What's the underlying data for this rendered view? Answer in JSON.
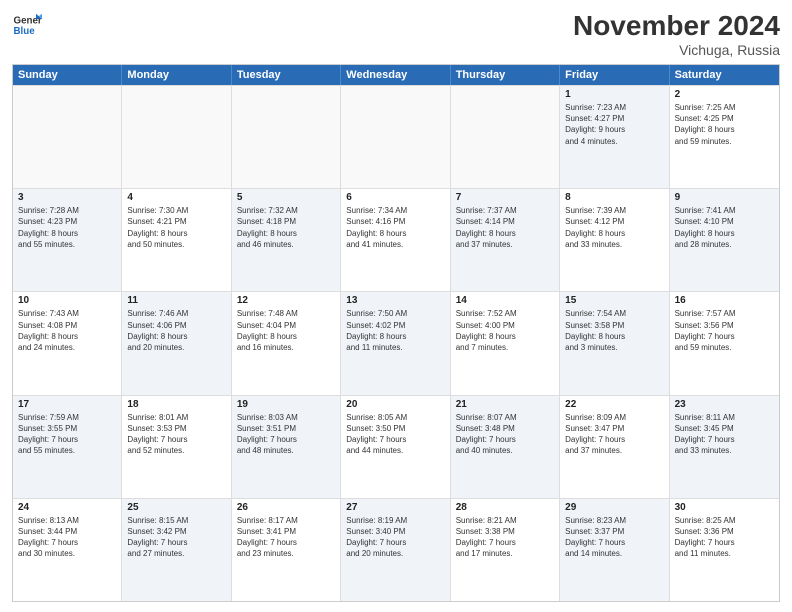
{
  "logo": {
    "line1": "General",
    "line2": "Blue"
  },
  "title": "November 2024",
  "location": "Vichuga, Russia",
  "days": [
    "Sunday",
    "Monday",
    "Tuesday",
    "Wednesday",
    "Thursday",
    "Friday",
    "Saturday"
  ],
  "rows": [
    [
      {
        "day": "",
        "text": "",
        "empty": true
      },
      {
        "day": "",
        "text": "",
        "empty": true
      },
      {
        "day": "",
        "text": "",
        "empty": true
      },
      {
        "day": "",
        "text": "",
        "empty": true
      },
      {
        "day": "",
        "text": "",
        "empty": true
      },
      {
        "day": "1",
        "text": "Sunrise: 7:23 AM\nSunset: 4:27 PM\nDaylight: 9 hours\nand 4 minutes.",
        "alt": true
      },
      {
        "day": "2",
        "text": "Sunrise: 7:25 AM\nSunset: 4:25 PM\nDaylight: 8 hours\nand 59 minutes.",
        "alt": false
      }
    ],
    [
      {
        "day": "3",
        "text": "Sunrise: 7:28 AM\nSunset: 4:23 PM\nDaylight: 8 hours\nand 55 minutes.",
        "alt": true
      },
      {
        "day": "4",
        "text": "Sunrise: 7:30 AM\nSunset: 4:21 PM\nDaylight: 8 hours\nand 50 minutes.",
        "alt": false
      },
      {
        "day": "5",
        "text": "Sunrise: 7:32 AM\nSunset: 4:18 PM\nDaylight: 8 hours\nand 46 minutes.",
        "alt": true
      },
      {
        "day": "6",
        "text": "Sunrise: 7:34 AM\nSunset: 4:16 PM\nDaylight: 8 hours\nand 41 minutes.",
        "alt": false
      },
      {
        "day": "7",
        "text": "Sunrise: 7:37 AM\nSunset: 4:14 PM\nDaylight: 8 hours\nand 37 minutes.",
        "alt": true
      },
      {
        "day": "8",
        "text": "Sunrise: 7:39 AM\nSunset: 4:12 PM\nDaylight: 8 hours\nand 33 minutes.",
        "alt": false
      },
      {
        "day": "9",
        "text": "Sunrise: 7:41 AM\nSunset: 4:10 PM\nDaylight: 8 hours\nand 28 minutes.",
        "alt": true
      }
    ],
    [
      {
        "day": "10",
        "text": "Sunrise: 7:43 AM\nSunset: 4:08 PM\nDaylight: 8 hours\nand 24 minutes.",
        "alt": false
      },
      {
        "day": "11",
        "text": "Sunrise: 7:46 AM\nSunset: 4:06 PM\nDaylight: 8 hours\nand 20 minutes.",
        "alt": true
      },
      {
        "day": "12",
        "text": "Sunrise: 7:48 AM\nSunset: 4:04 PM\nDaylight: 8 hours\nand 16 minutes.",
        "alt": false
      },
      {
        "day": "13",
        "text": "Sunrise: 7:50 AM\nSunset: 4:02 PM\nDaylight: 8 hours\nand 11 minutes.",
        "alt": true
      },
      {
        "day": "14",
        "text": "Sunrise: 7:52 AM\nSunset: 4:00 PM\nDaylight: 8 hours\nand 7 minutes.",
        "alt": false
      },
      {
        "day": "15",
        "text": "Sunrise: 7:54 AM\nSunset: 3:58 PM\nDaylight: 8 hours\nand 3 minutes.",
        "alt": true
      },
      {
        "day": "16",
        "text": "Sunrise: 7:57 AM\nSunset: 3:56 PM\nDaylight: 7 hours\nand 59 minutes.",
        "alt": false
      }
    ],
    [
      {
        "day": "17",
        "text": "Sunrise: 7:59 AM\nSunset: 3:55 PM\nDaylight: 7 hours\nand 55 minutes.",
        "alt": true
      },
      {
        "day": "18",
        "text": "Sunrise: 8:01 AM\nSunset: 3:53 PM\nDaylight: 7 hours\nand 52 minutes.",
        "alt": false
      },
      {
        "day": "19",
        "text": "Sunrise: 8:03 AM\nSunset: 3:51 PM\nDaylight: 7 hours\nand 48 minutes.",
        "alt": true
      },
      {
        "day": "20",
        "text": "Sunrise: 8:05 AM\nSunset: 3:50 PM\nDaylight: 7 hours\nand 44 minutes.",
        "alt": false
      },
      {
        "day": "21",
        "text": "Sunrise: 8:07 AM\nSunset: 3:48 PM\nDaylight: 7 hours\nand 40 minutes.",
        "alt": true
      },
      {
        "day": "22",
        "text": "Sunrise: 8:09 AM\nSunset: 3:47 PM\nDaylight: 7 hours\nand 37 minutes.",
        "alt": false
      },
      {
        "day": "23",
        "text": "Sunrise: 8:11 AM\nSunset: 3:45 PM\nDaylight: 7 hours\nand 33 minutes.",
        "alt": true
      }
    ],
    [
      {
        "day": "24",
        "text": "Sunrise: 8:13 AM\nSunset: 3:44 PM\nDaylight: 7 hours\nand 30 minutes.",
        "alt": false
      },
      {
        "day": "25",
        "text": "Sunrise: 8:15 AM\nSunset: 3:42 PM\nDaylight: 7 hours\nand 27 minutes.",
        "alt": true
      },
      {
        "day": "26",
        "text": "Sunrise: 8:17 AM\nSunset: 3:41 PM\nDaylight: 7 hours\nand 23 minutes.",
        "alt": false
      },
      {
        "day": "27",
        "text": "Sunrise: 8:19 AM\nSunset: 3:40 PM\nDaylight: 7 hours\nand 20 minutes.",
        "alt": true
      },
      {
        "day": "28",
        "text": "Sunrise: 8:21 AM\nSunset: 3:38 PM\nDaylight: 7 hours\nand 17 minutes.",
        "alt": false
      },
      {
        "day": "29",
        "text": "Sunrise: 8:23 AM\nSunset: 3:37 PM\nDaylight: 7 hours\nand 14 minutes.",
        "alt": true
      },
      {
        "day": "30",
        "text": "Sunrise: 8:25 AM\nSunset: 3:36 PM\nDaylight: 7 hours\nand 11 minutes.",
        "alt": false
      }
    ]
  ]
}
